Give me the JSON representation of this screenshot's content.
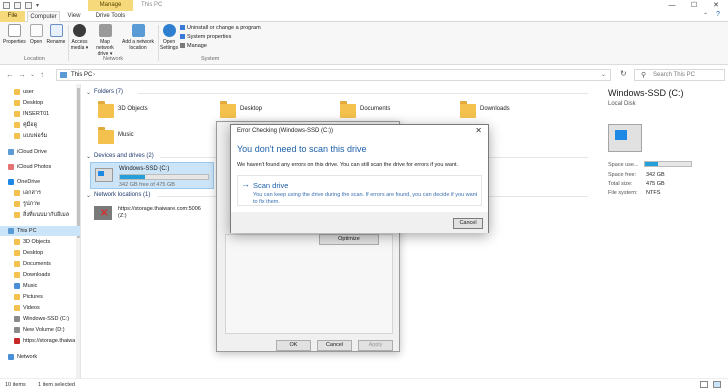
{
  "titlebar": {
    "manage_tab": "Manage",
    "title": "This PC",
    "minimize": "—",
    "maximize": "☐",
    "close": "✕"
  },
  "ribbon_tabs": {
    "file": "File",
    "computer": "Computer",
    "view": "View",
    "drive_tools": "Drive Tools"
  },
  "ribbon": {
    "properties": "Properties",
    "open": "Open",
    "rename": "Rename",
    "access_media": "Access media ▾",
    "map_network_drive": "Map network drive ▾",
    "add_network_location": "Add a network location",
    "open_settings": "Open Settings",
    "uninstall": "Uninstall or change a program",
    "system_properties": "System properties",
    "manage": "Manage",
    "group_location": "Location",
    "group_network": "Network",
    "group_system": "System"
  },
  "address": {
    "path": "This PC",
    "search_placeholder": "Search This PC"
  },
  "nav": {
    "items": [
      {
        "label": "user",
        "icon": "folder-icon"
      },
      {
        "label": "Desktop",
        "icon": "folder-icon"
      },
      {
        "label": "INSERT01",
        "icon": "folder-icon"
      },
      {
        "label": "คู่มือดู",
        "icon": "folder-icon"
      },
      {
        "label": "แบบฟอร์ม",
        "icon": "folder-icon"
      },
      {
        "label": "iCloud Drive",
        "icon": "cloud-icon"
      },
      {
        "label": "iCloud Photos",
        "icon": "photos-icon"
      },
      {
        "label": "OneDrive",
        "icon": "onedrive-icon"
      },
      {
        "label": "เอกสาร",
        "icon": "folder-icon"
      },
      {
        "label": "รูปภาพ",
        "icon": "folder-icon"
      },
      {
        "label": "สิ่งที่แนบมากับอีเมล",
        "icon": "folder-icon"
      },
      {
        "label": "This PC",
        "icon": "pc-icon"
      },
      {
        "label": "3D Objects",
        "icon": "folder-icon"
      },
      {
        "label": "Desktop",
        "icon": "folder-icon"
      },
      {
        "label": "Documents",
        "icon": "folder-icon"
      },
      {
        "label": "Downloads",
        "icon": "folder-icon"
      },
      {
        "label": "Music",
        "icon": "music-icon"
      },
      {
        "label": "Pictures",
        "icon": "folder-icon"
      },
      {
        "label": "Videos",
        "icon": "folder-icon"
      },
      {
        "label": "Windows-SSD (C:)",
        "icon": "drive-icon"
      },
      {
        "label": "New Volume (D:)",
        "icon": "drive-icon"
      },
      {
        "label": "https://storage.thaiwa",
        "icon": "network-drive-icon"
      },
      {
        "label": "Network",
        "icon": "network-icon"
      }
    ]
  },
  "content": {
    "folders_header": "Folders (7)",
    "folders": [
      "3D Objects",
      "Desktop",
      "Documents",
      "Downloads",
      "Music"
    ],
    "devices_header": "Devices and drives (2)",
    "drive_name": "Windows-SSD (C:)",
    "drive_free": "342 GB free of 475 GB",
    "drive_used_fraction": 0.28,
    "network_header": "Network locations (1)",
    "network_label_1": "https://storage.thaiware.com:5006",
    "network_label_2": "(Z:)"
  },
  "details": {
    "title": "Windows-SSD (C:)",
    "subtitle": "Local Disk",
    "space_used_label": "Space use...",
    "space_used_fraction": 0.28,
    "space_free_label": "Space free:",
    "space_free_value": "342 GB",
    "total_size_label": "Total size:",
    "total_size_value": "475 GB",
    "file_system_label": "File system:",
    "file_system_value": "NTFS"
  },
  "statusbar": {
    "count": "10 items",
    "selected": "1 item selected"
  },
  "properties_dialog": {
    "optimize": "Optimize",
    "ok": "OK",
    "cancel": "Cancel",
    "apply": "Apply"
  },
  "error_dialog": {
    "title": "Error Checking (Windows-SSD (C:))",
    "close": "✕",
    "heading": "You don't need to scan this drive",
    "body": "We haven't found any errors on this drive. You can still scan the drive for errors if you want.",
    "scan_title": "Scan drive",
    "scan_desc": "You can keep using the drive during the scan. If errors are found, you can decide if you want to fix them.",
    "cancel": "Cancel"
  },
  "colors": {
    "accent": "#26a0da",
    "link": "#1c5fa8",
    "manage_tab": "#f5d97a"
  }
}
